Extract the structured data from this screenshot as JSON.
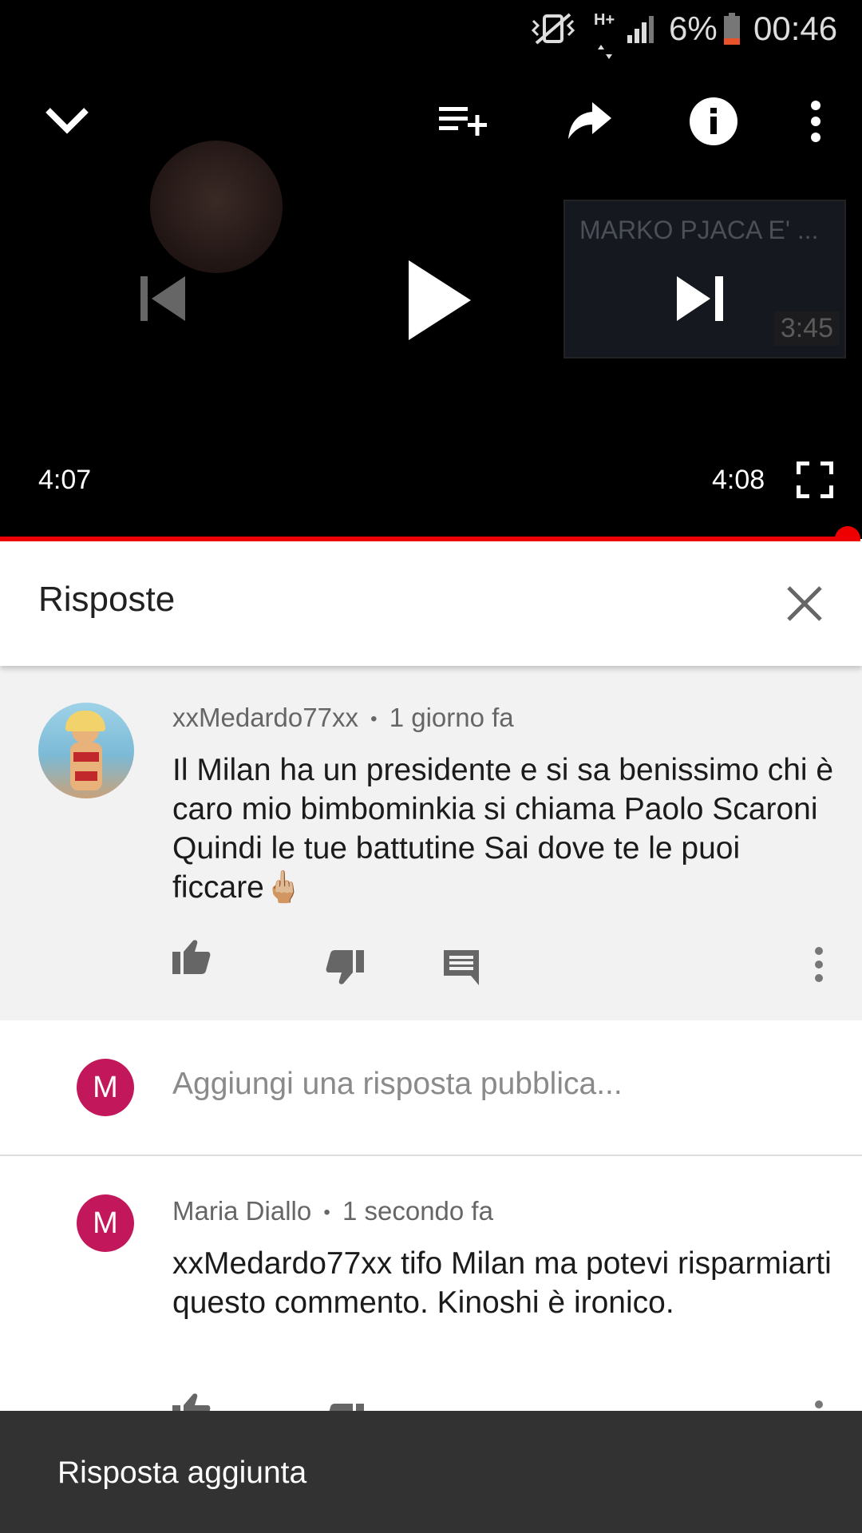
{
  "status_bar": {
    "network": "H+",
    "battery": "6%",
    "time": "00:46"
  },
  "player": {
    "next_video_title": "MARKO PJACA E' ...",
    "next_video_duration": "3:45",
    "current_time": "4:07",
    "duration": "4:08",
    "progress": 0.996
  },
  "replies_panel": {
    "title": "Risposte"
  },
  "main_comment": {
    "author": "xxMedardo77xx",
    "time": "1 giorno fa",
    "text": "Il Milan ha un presidente e si sa benissimo chi è caro mio bimbominkia si chiama Paolo Scaroni Quindi le tue battutine Sai dove te le puoi ficcare🖕🏼"
  },
  "reply_input": {
    "avatar_letter": "M",
    "placeholder": "Aggiungi una risposta pubblica..."
  },
  "reply": {
    "avatar_letter": "M",
    "author": "Maria Diallo",
    "time": "1 secondo fa",
    "text": "xxMedardo77xx tifo Milan ma potevi risparmiarti questo commento. Kinoshi è ironico."
  },
  "meta_separator": "•",
  "snackbar": {
    "text": "Risposta aggiunta"
  },
  "colors": {
    "accent_red": "#e00000",
    "avatar_pink": "#c2185b",
    "snackbar_bg": "#323232"
  }
}
